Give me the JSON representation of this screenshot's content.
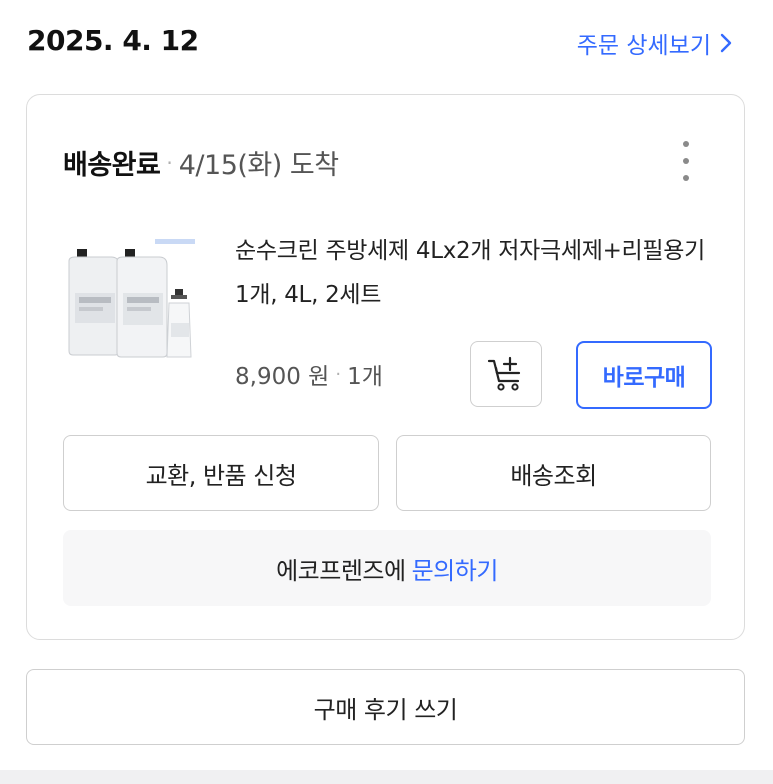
{
  "order": {
    "date": "2025. 4. 12",
    "detail_link_label": "주문 상세보기"
  },
  "card": {
    "status_label": "배송완료",
    "status_separator": "·",
    "arrival_text": "4/15(화) 도착",
    "product": {
      "name": "순수크린 주방세제 4Lx2개 저자극세제+리필용기1개, 4L, 2세트",
      "price": "8,900 원",
      "separator": "·",
      "quantity": "1개"
    },
    "buy_now_label": "바로구매",
    "exchange_return_label": "교환, 반품 신청",
    "tracking_label": "배송조회",
    "inquiry": {
      "seller_text": "에코프렌즈에",
      "link_label": "문의하기"
    }
  },
  "review_button_label": "구매 후기 쓰기",
  "colors": {
    "accent": "#346aff",
    "border": "#dcdcdc",
    "inquiry_background": "#f7f7f8"
  },
  "icons": {
    "detail_chevron": "chevron-right-icon",
    "more": "more-vertical-icon",
    "cart": "add-to-cart-icon"
  }
}
